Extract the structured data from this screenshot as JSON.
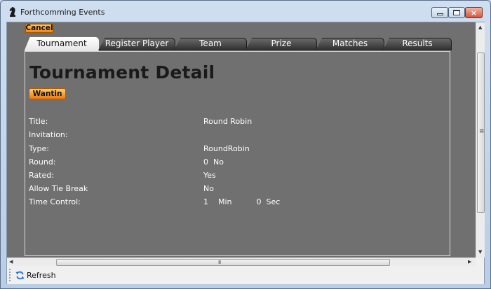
{
  "window": {
    "title": "Forthcomming Events",
    "close_glyph": "×"
  },
  "cancel_label": "Cancel",
  "tabs": [
    {
      "label": "Tournament",
      "active": true
    },
    {
      "label": "Register Player",
      "active": false
    },
    {
      "label": "Team",
      "active": false
    },
    {
      "label": "Prize",
      "active": false
    },
    {
      "label": "Matches",
      "active": false
    },
    {
      "label": "Results",
      "active": false
    }
  ],
  "detail": {
    "heading": "Tournament Detail",
    "wantin_label": "Wantin",
    "fields": [
      {
        "label": "Title:",
        "value": "Round Robin"
      },
      {
        "label": "Invitation:",
        "value": ""
      },
      {
        "label": "Type:",
        "value": "RoundRobin"
      },
      {
        "label": "Round:",
        "value": "0  No"
      },
      {
        "label": "Rated:",
        "value": "Yes"
      },
      {
        "label": "Allow Tie Break",
        "value": "No"
      },
      {
        "label": "Time Control:",
        "value": "1    Min          0  Sec"
      }
    ]
  },
  "scroll": {
    "up_arrow": "▲",
    "down_arrow": "▼",
    "left_arrow": "◀",
    "right_arrow": "▶",
    "grip_h": "III",
    "grip_v": "≡"
  },
  "toolbar": {
    "refresh_label": "Refresh"
  },
  "colors": {
    "panel_bg": "#707070",
    "accent_orange": "#f07f10",
    "label_text": "#ffffff"
  },
  "icons": {
    "app": "chess-knight-icon",
    "refresh": "refresh-icon"
  }
}
